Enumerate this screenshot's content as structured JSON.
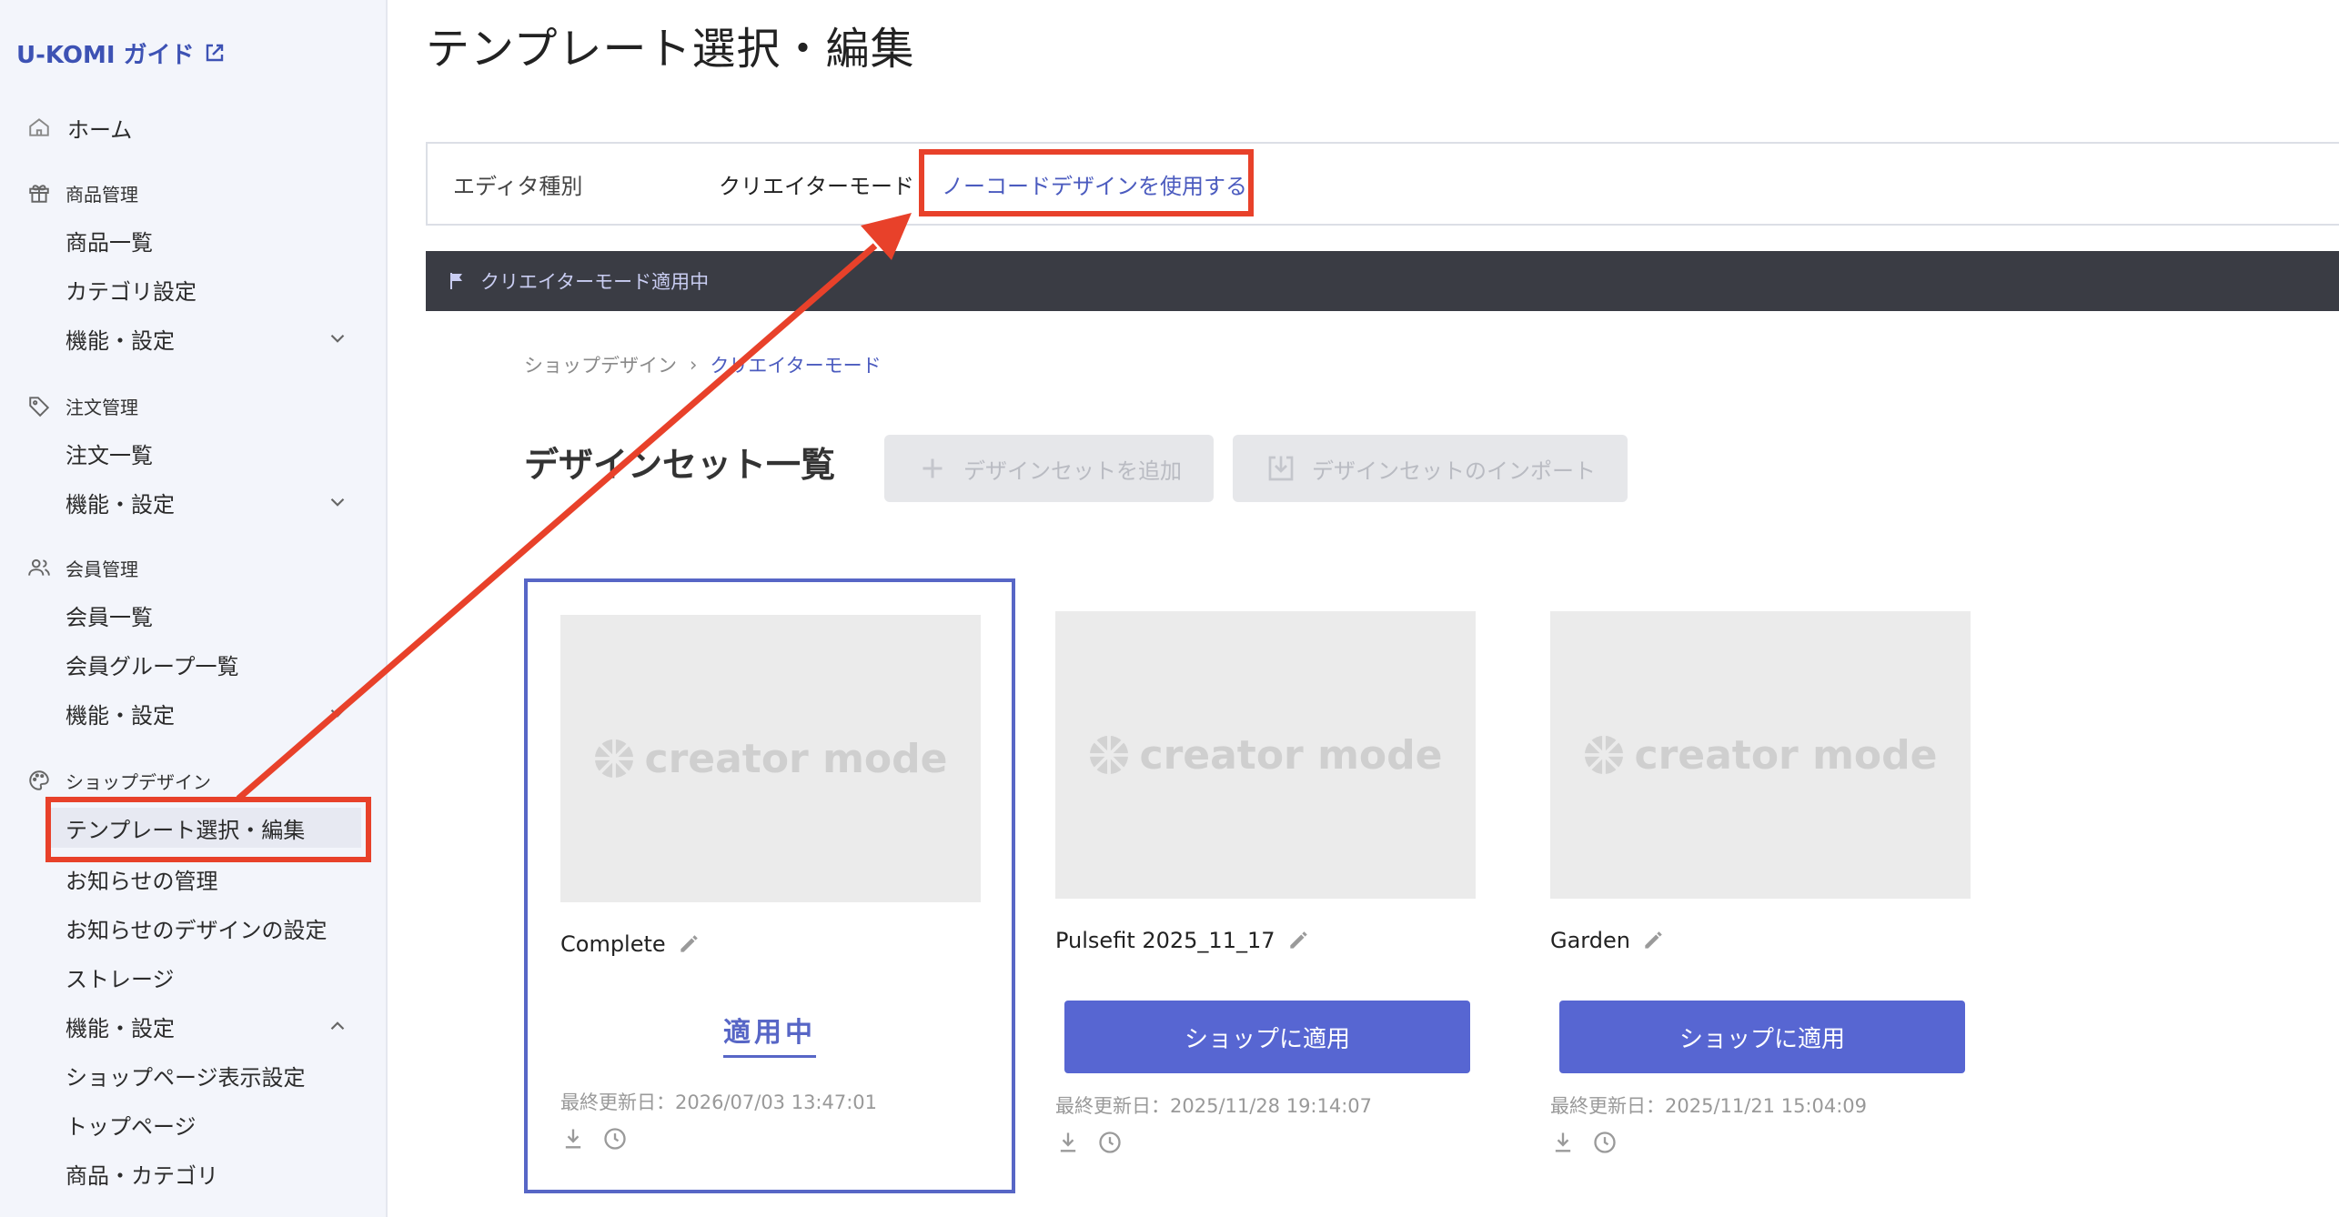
{
  "sidebar": {
    "brand": "U-KOMI ガイド",
    "home": "ホーム",
    "sections": [
      {
        "title": "商品管理",
        "items": [
          "商品一覧",
          "カテゴリ設定",
          "機能・設定"
        ]
      },
      {
        "title": "注文管理",
        "items": [
          "注文一覧",
          "機能・設定"
        ]
      },
      {
        "title": "会員管理",
        "items": [
          "会員一覧",
          "会員グループ一覧",
          "機能・設定"
        ]
      },
      {
        "title": "ショップデザイン",
        "items": [
          "テンプレート選択・編集",
          "お知らせの管理",
          "お知らせのデザインの設定",
          "ストレージ",
          "機能・設定",
          "ショップページ表示設定",
          "トップページ",
          "商品・カテゴリ"
        ]
      }
    ]
  },
  "main": {
    "title": "テンプレート選択・編集",
    "editor": {
      "label": "エディタ種別",
      "mode": "クリエイターモード",
      "link": "ノーコードデザインを使用する"
    },
    "banner": "クリエイターモード適用中",
    "breadcrumb": {
      "parent": "ショップデザイン",
      "current": "クリエイターモード"
    },
    "section_title": "デザインセット一覧",
    "add_button": "デザインセットを追加",
    "import_button": "デザインセットのインポート",
    "thumb_text": "creator mode",
    "cards": [
      {
        "name": "Complete",
        "status": "適用中",
        "updated": "最終更新日：2026/07/03 13:47:01"
      },
      {
        "name": "Pulsefit 2025_11_17",
        "button": "ショップに適用",
        "updated": "最終更新日：2025/11/28 19:14:07"
      },
      {
        "name": "Garden",
        "button": "ショップに適用",
        "updated": "最終更新日：2025/11/21 15:04:09"
      }
    ]
  },
  "colors": {
    "accent": "#5766d2",
    "highlight": "#e8412a",
    "banner": "#3a3c44"
  }
}
